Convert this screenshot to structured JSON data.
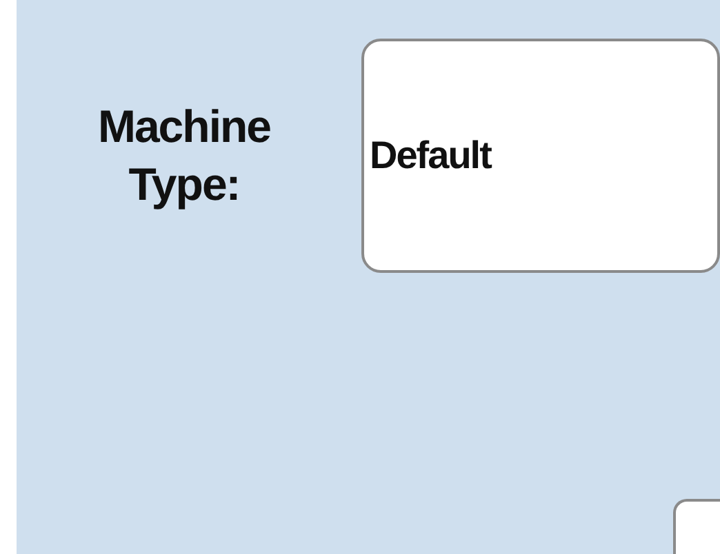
{
  "fields": [
    {
      "label": "Machine Type:",
      "value": "Default"
    }
  ]
}
